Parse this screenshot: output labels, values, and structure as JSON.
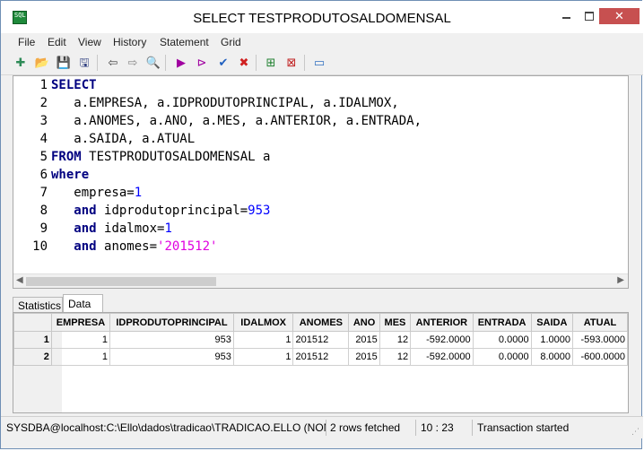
{
  "window": {
    "title": "SELECT TESTPRODUTOSALDOMENSAL",
    "app_icon_text": "SQL",
    "minimize_icon": "minimize-icon",
    "maximize_icon": "maximize-icon",
    "close_label": "✕"
  },
  "menu": [
    "File",
    "Edit",
    "View",
    "History",
    "Statement",
    "Grid"
  ],
  "toolbar": [
    {
      "name": "new-statement-icon",
      "glyph": "✚",
      "color": "#2e8b57"
    },
    {
      "name": "open-icon",
      "glyph": "📂",
      "color": "#c8a040"
    },
    {
      "name": "save-icon",
      "glyph": "💾",
      "color": "#304080"
    },
    {
      "name": "save-as-icon",
      "glyph": "🖫",
      "color": "#304080"
    },
    {
      "name": "back-icon",
      "glyph": "⇦",
      "color": "#444444"
    },
    {
      "name": "forward-icon",
      "glyph": "⇨",
      "color": "#888888"
    },
    {
      "name": "find-icon",
      "glyph": "🔍",
      "color": "#444444"
    },
    {
      "name": "execute-icon",
      "glyph": "▶",
      "color": "#a000a0"
    },
    {
      "name": "prepare-icon",
      "glyph": "⊳",
      "color": "#a000a0"
    },
    {
      "name": "commit-icon",
      "glyph": "✔",
      "color": "#2060c0"
    },
    {
      "name": "rollback-icon",
      "glyph": "✖",
      "color": "#d02020"
    },
    {
      "name": "add-row-icon",
      "glyph": "⊞",
      "color": "#208030"
    },
    {
      "name": "delete-row-icon",
      "glyph": "⊠",
      "color": "#c02020"
    },
    {
      "name": "layout-toggle-icon",
      "glyph": "▭",
      "color": "#3070c0"
    }
  ],
  "editor": {
    "lines": [
      {
        "num": "1",
        "parts": [
          {
            "t": "SELECT",
            "c": "kw"
          }
        ]
      },
      {
        "num": "2",
        "parts": [
          {
            "t": "   a.EMPRESA, a.IDPRODUTOPRINCIPAL, a.IDALMOX,",
            "c": ""
          }
        ]
      },
      {
        "num": "3",
        "parts": [
          {
            "t": "   a.ANOMES, a.ANO, a.MES, a.ANTERIOR, a.ENTRADA,",
            "c": ""
          }
        ]
      },
      {
        "num": "4",
        "parts": [
          {
            "t": "   a.SAIDA, a.ATUAL",
            "c": ""
          }
        ]
      },
      {
        "num": "5",
        "parts": [
          {
            "t": "FROM",
            "c": "kw"
          },
          {
            "t": " TESTPRODUTOSALDOMENSAL a",
            "c": ""
          }
        ]
      },
      {
        "num": "6",
        "parts": [
          {
            "t": "where",
            "c": "kw"
          }
        ]
      },
      {
        "num": "7",
        "parts": [
          {
            "t": "   empresa=",
            "c": ""
          },
          {
            "t": "1",
            "c": "num"
          }
        ]
      },
      {
        "num": "8",
        "parts": [
          {
            "t": "   ",
            "c": ""
          },
          {
            "t": "and",
            "c": "kw"
          },
          {
            "t": " idprodutoprincipal=",
            "c": ""
          },
          {
            "t": "953",
            "c": "num"
          }
        ]
      },
      {
        "num": "9",
        "parts": [
          {
            "t": "   ",
            "c": ""
          },
          {
            "t": "and",
            "c": "kw"
          },
          {
            "t": " idalmox=",
            "c": ""
          },
          {
            "t": "1",
            "c": "num"
          }
        ]
      },
      {
        "num": "10",
        "parts": [
          {
            "t": "   ",
            "c": ""
          },
          {
            "t": "and",
            "c": "kw"
          },
          {
            "t": " anomes=",
            "c": ""
          },
          {
            "t": "'201512'",
            "c": "str"
          }
        ]
      }
    ],
    "scroll_left_glyph": "◀",
    "scroll_right_glyph": "▶"
  },
  "tabs": {
    "statistics": "Statistics",
    "data": "Data"
  },
  "grid": {
    "columns": [
      "EMPRESA",
      "IDPRODUTOPRINCIPAL",
      "IDALMOX",
      "ANOMES",
      "ANO",
      "MES",
      "ANTERIOR",
      "ENTRADA",
      "SAIDA",
      "ATUAL"
    ],
    "rows": [
      {
        "num": "1",
        "cells": [
          "1",
          "953",
          "1",
          "201512",
          "2015",
          "12",
          "-592.0000",
          "0.0000",
          "1.0000",
          "-593.0000"
        ]
      },
      {
        "num": "2",
        "cells": [
          "1",
          "953",
          "1",
          "201512",
          "2015",
          "12",
          "-592.0000",
          "0.0000",
          "8.0000",
          "-600.0000"
        ]
      }
    ]
  },
  "status": {
    "connection": "SYSDBA@localhost:C:\\Ello\\dados\\tradicao\\TRADICAO.ELLO (NON",
    "rows": "2 rows fetched",
    "position": "10 : 23",
    "transaction": "Transaction started"
  }
}
